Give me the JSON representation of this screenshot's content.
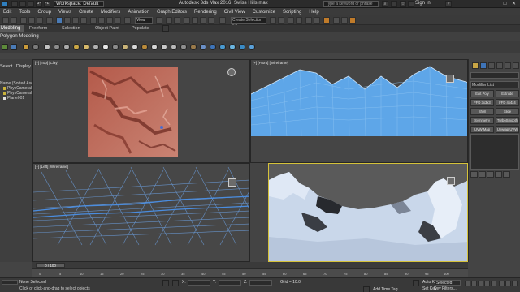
{
  "titlebar": {
    "workspace": "Workspace: Default",
    "app_title": "Autodesk 3ds Max 2016",
    "file_title": "Swiss Hills.max",
    "search_placeholder": "Type a keyword or phrase",
    "signin": "Sign In"
  },
  "menu": [
    "Edit",
    "Tools",
    "Group",
    "Views",
    "Create",
    "Modifiers",
    "Animation",
    "Graph Editors",
    "Rendering",
    "Civil View",
    "Customize",
    "Scripting",
    "Help"
  ],
  "toolbar": {
    "view_dropdown": "View",
    "selection_set": "Create Selection Se"
  },
  "ribbon": {
    "tabs": [
      "Modeling",
      "Freeform",
      "Selection",
      "Object Paint",
      "Populate"
    ],
    "panel_title": "Polygon Modeling"
  },
  "explorer": {
    "tabs": [
      "Select",
      "Display"
    ],
    "header": "Name (Sorted Ascendi",
    "items": [
      "PhysCamera00",
      "PhysCamera00",
      "Plane001"
    ]
  },
  "viewports": {
    "top": "[+] [Top] [Clay]",
    "front": "[+] [Front] [Wireframe]",
    "left": "[+] [Left] [Wireframe]",
    "perspective": "[+] [Perspective] [Shaded]"
  },
  "command_panel": {
    "modifier_list": "Modifier List",
    "buttons": [
      [
        "Edit Poly",
        "Extrude"
      ],
      [
        "FFD 3x3x3",
        "FFD 4x4x4"
      ],
      [
        "Shell",
        "Slice"
      ],
      [
        "Symmetry",
        "TurboSmooth"
      ],
      [
        "UVW Map",
        "Unwrap UVW"
      ]
    ]
  },
  "timeline": {
    "slider": "0 / 100",
    "ticks": [
      "0",
      "5",
      "10",
      "15",
      "20",
      "25",
      "30",
      "35",
      "40",
      "45",
      "50",
      "55",
      "60",
      "65",
      "70",
      "75",
      "80",
      "85",
      "90",
      "95",
      "100"
    ]
  },
  "status": {
    "line1": "None Selected",
    "line2": "Click or click-and-drag to select objects",
    "x_label": "X:",
    "y_label": "Y:",
    "z_label": "Z:",
    "grid": "Grid = 10.0",
    "add_time_tag": "Add Time Tag",
    "auto_key": "Auto Key",
    "set_key": "Set Key",
    "selected": "Selected",
    "key_filters": "Key Filters..."
  }
}
